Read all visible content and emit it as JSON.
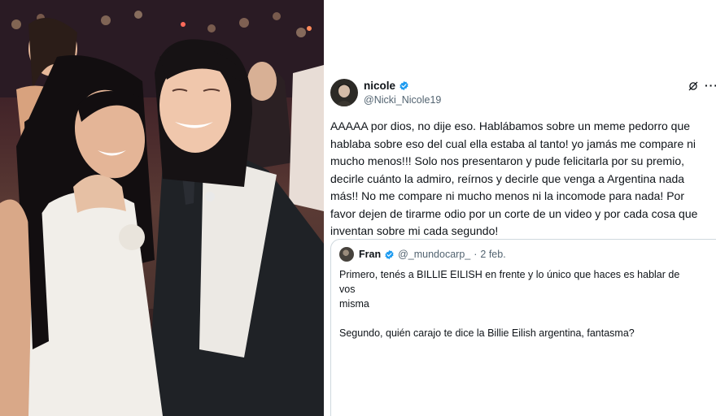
{
  "photo": {
    "description_icon": "photo-image"
  },
  "tweet": {
    "display_name": "nicole",
    "handle": "@Nicki_Nicole19",
    "verified_icon": "verified-badge-icon",
    "grok_icon": "grok-icon",
    "more_icon": "more-options-icon",
    "more_glyph": "···",
    "body": "AAAAA por dios, no dije eso. Hablábamos sobre un meme pedorro que\nhablaba sobre eso del cual ella estaba al tanto! yo jamás me compare ni\nmucho menos!!! Solo nos presentaron y pude felicitarla por su premio,\ndecirle cuánto la admiro, reírnos y decirle que venga a Argentina nada\nmás!! No me compare ni mucho menos ni la incomode para nada! Por\nfavor dejen de tirarme odio por un corte de un video y por cada cosa que\ninventan sobre mi cada segundo!"
  },
  "quoted_tweet": {
    "display_name": "Fran",
    "handle": "@_mundocarp_",
    "separator": "·",
    "date": "2 feb.",
    "body": "Primero, tenés a BILLIE EILISH en frente y lo único que haces es hablar de vos\nmisma\n\nSegundo, quién carajo te dice la Billie Eilish argentina, fantasma?"
  },
  "colors": {
    "verified": "#1d9bf0",
    "text": "#0f1419",
    "secondary": "#536471",
    "border": "#cfd9de"
  }
}
